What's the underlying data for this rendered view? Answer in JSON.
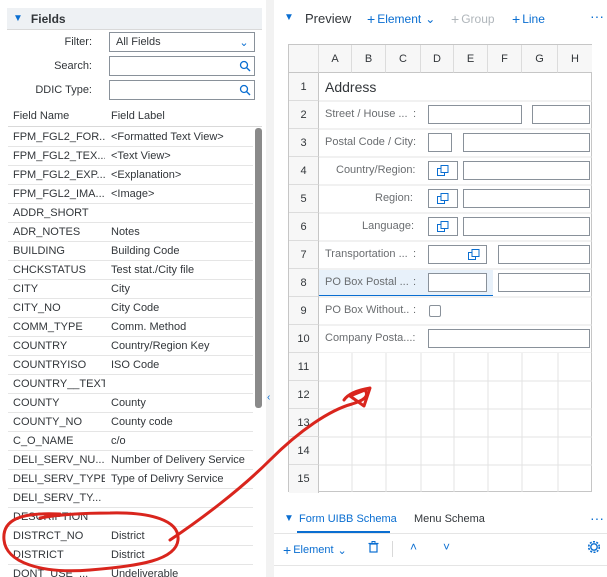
{
  "fields_panel": {
    "title": "Fields",
    "filter": {
      "label": "Filter:",
      "value": "All Fields"
    },
    "search": {
      "label": "Search:",
      "value": "",
      "placeholder": ""
    },
    "ddic": {
      "label": "DDIC Type:",
      "value": "",
      "placeholder": ""
    },
    "columns": {
      "field_name": "Field Name",
      "field_label": "Field Label"
    },
    "rows": [
      {
        "name": "FPM_FGL2_FOR...",
        "label": "<Formatted Text View>"
      },
      {
        "name": "FPM_FGL2_TEX...",
        "label": "<Text View>"
      },
      {
        "name": "FPM_FGL2_EXP...",
        "label": "<Explanation>"
      },
      {
        "name": "FPM_FGL2_IMA...",
        "label": "<Image>"
      },
      {
        "name": "ADDR_SHORT",
        "label": ""
      },
      {
        "name": "ADR_NOTES",
        "label": "Notes"
      },
      {
        "name": "BUILDING",
        "label": "Building Code"
      },
      {
        "name": "CHCKSTATUS",
        "label": "Test stat./City file"
      },
      {
        "name": "CITY",
        "label": "City"
      },
      {
        "name": "CITY_NO",
        "label": "City Code"
      },
      {
        "name": "COMM_TYPE",
        "label": "Comm. Method"
      },
      {
        "name": "COUNTRY",
        "label": "Country/Region Key"
      },
      {
        "name": "COUNTRYISO",
        "label": "ISO Code"
      },
      {
        "name": "COUNTRY__TEXT",
        "label": ""
      },
      {
        "name": "COUNTY",
        "label": "County"
      },
      {
        "name": "COUNTY_NO",
        "label": "County code"
      },
      {
        "name": "C_O_NAME",
        "label": "c/o"
      },
      {
        "name": "DELI_SERV_NU...",
        "label": "Number of Delivery Service"
      },
      {
        "name": "DELI_SERV_TYPE",
        "label": "Type of Delivry Service"
      },
      {
        "name": "DELI_SERV_TY...",
        "label": ""
      },
      {
        "name": "DESCRIPTION",
        "label": ""
      },
      {
        "name": "DISTRCT_NO",
        "label": "District"
      },
      {
        "name": "DISTRICT",
        "label": "District"
      },
      {
        "name": "DONT_USE_...",
        "label": "Undeliverable"
      }
    ]
  },
  "preview": {
    "title": "Preview",
    "element_label": "Element",
    "group_label": "Group",
    "line_label": "Line",
    "columns": [
      "A",
      "B",
      "C",
      "D",
      "E",
      "F",
      "G",
      "H"
    ],
    "rows": [
      "1",
      "2",
      "3",
      "4",
      "5",
      "6",
      "7",
      "8",
      "9",
      "10",
      "11",
      "12",
      "13",
      "14",
      "15"
    ],
    "labels": {
      "address": "Address",
      "street": "Street / House ...",
      "postal_city": "Postal Code / City:",
      "country": "Country/Region:",
      "region": "Region:",
      "language": "Language:",
      "transportation": "Transportation ...",
      "po_box_postal": "PO Box Postal ...",
      "po_box_without": "PO Box Without...",
      "company_postal": "Company Posta...:",
      "colon": ":"
    }
  },
  "bottom": {
    "tab_form": "Form UIBB Schema",
    "tab_menu": "Menu Schema",
    "element_label": "Element"
  },
  "colors": {
    "accent": "#0a6ed1",
    "annotation": "#d9251d"
  }
}
